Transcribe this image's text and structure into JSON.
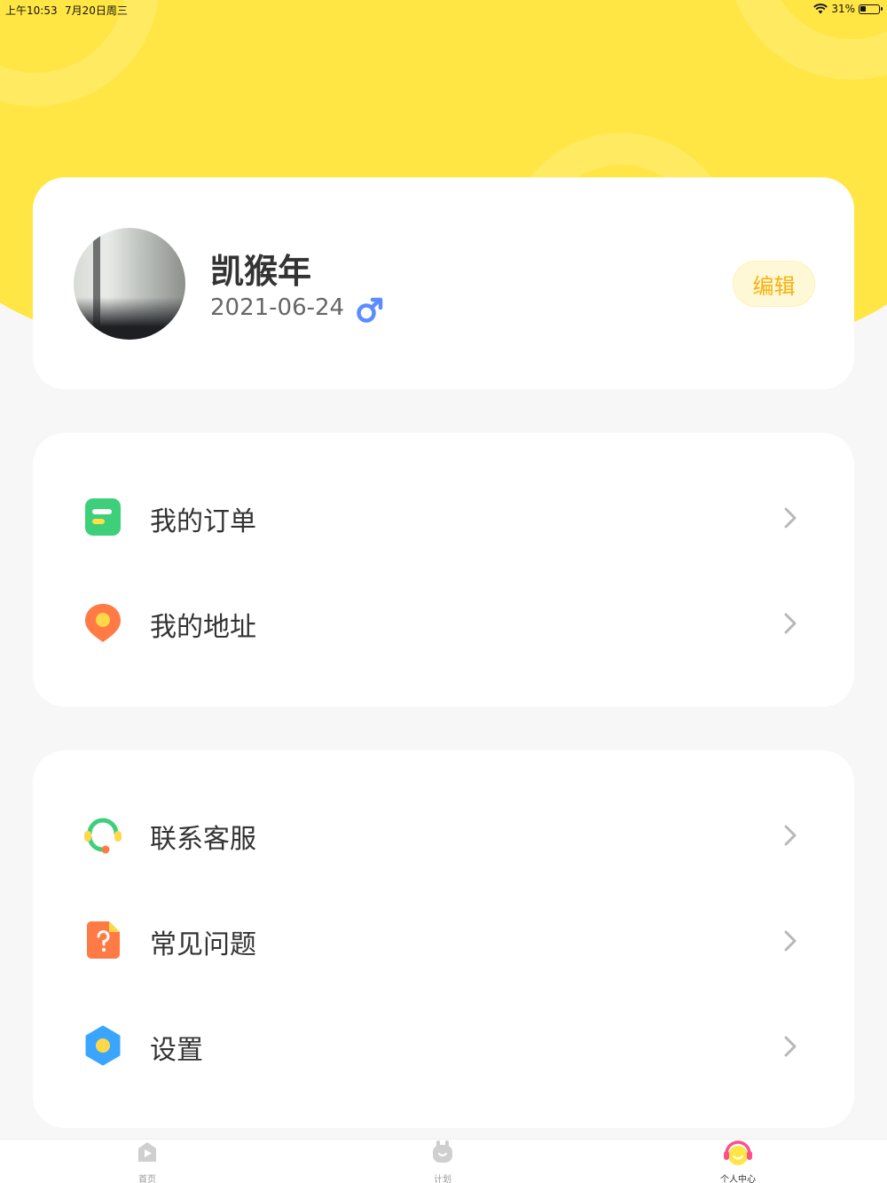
{
  "status_bar": {
    "time": "上午10:53",
    "date": "7月20日周三",
    "battery": "31%",
    "battery_level": 0.31
  },
  "profile": {
    "name": "凯猴年",
    "birthday": "2021-06-24",
    "gender_symbol": "male-icon",
    "edit_label": "编辑"
  },
  "menu_group_1": [
    {
      "label": "我的订单",
      "icon": "order-list-icon"
    },
    {
      "label": "我的地址",
      "icon": "location-pin-icon"
    }
  ],
  "menu_group_2": [
    {
      "label": "联系客服",
      "icon": "headset-icon"
    },
    {
      "label": "常见问题",
      "icon": "question-doc-icon"
    },
    {
      "label": "设置",
      "icon": "settings-icon"
    }
  ],
  "tab_bar": {
    "tabs": [
      {
        "label": "首页",
        "icon": "home-play-icon",
        "active": false
      },
      {
        "label": "计划",
        "icon": "plan-bunny-icon",
        "active": false
      },
      {
        "label": "个人中心",
        "icon": "profile-headphone-icon",
        "active": true
      }
    ]
  },
  "colors": {
    "accent_yellow": "#ffe645",
    "edit_text": "#f6b10e",
    "gender_blue": "#5b8cff",
    "order_green": "#3ecf7b",
    "pin_orange": "#ff7a45",
    "settings_blue": "#3aa5ff"
  }
}
